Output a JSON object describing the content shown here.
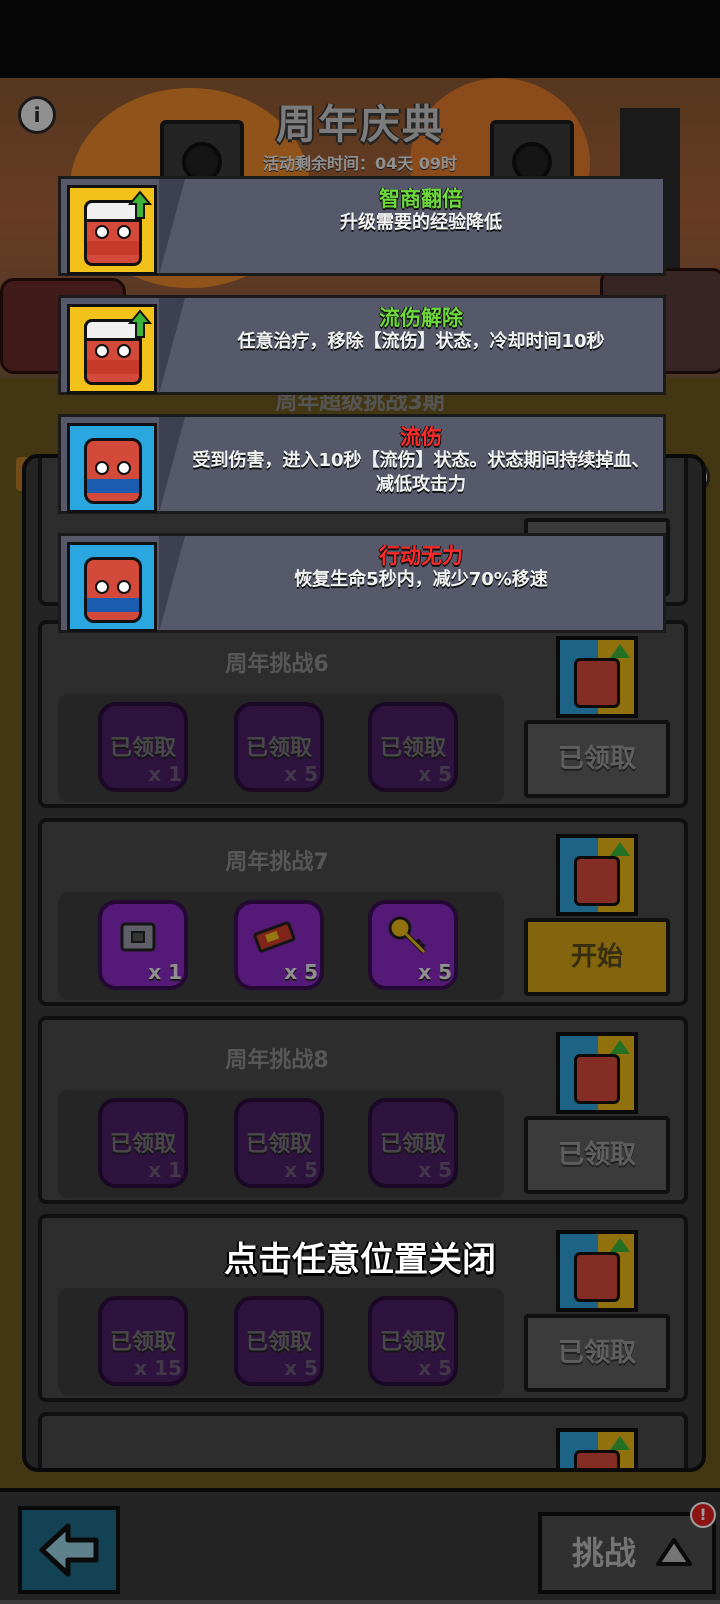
{
  "event": {
    "title": "周年庆典",
    "remaining_time": "活动剩余时间：04天 09时",
    "ribbon": "周年超级挑战3期"
  },
  "tooltips": [
    {
      "name": "智商翻倍",
      "desc": "升级需要的经验降低",
      "name_color": "#6dd83a",
      "icon_bg": "#f2c21a",
      "icon": "hero-upgrade-icon"
    },
    {
      "name": "流伤解除",
      "desc": "任意治疗，移除【流伤】状态，冷却时间10秒",
      "name_color": "#6dd83a",
      "icon_bg": "#f2c21a",
      "icon": "hero-upgrade-icon"
    },
    {
      "name": "流伤",
      "desc": "受到伤害，进入10秒【流伤】状态。状态期间持续掉血、减低攻击力",
      "name_color": "#ff2a2a",
      "icon_bg": "#2aa6e0",
      "icon": "red-slime-icon"
    },
    {
      "name": "行动无力",
      "desc": "恢复生命5秒内，减少70%移速",
      "name_color": "#ff2a2a",
      "icon_bg": "#2aa6e0",
      "icon": "red-slime-icon"
    }
  ],
  "challenges": [
    {
      "title": "周年挑战6",
      "button": "已领取",
      "state": "done",
      "rewards": [
        {
          "qty": "x 1",
          "label": "已领取",
          "icon": "chest-icon"
        },
        {
          "qty": "x 5",
          "label": "已领取",
          "icon": "ticket-icon"
        },
        {
          "qty": "x 5",
          "label": "已领取",
          "icon": "key-icon"
        }
      ]
    },
    {
      "title": "周年挑战7",
      "button": "开始",
      "state": "start",
      "rewards": [
        {
          "qty": "x 1",
          "label": "",
          "icon": "chest-icon"
        },
        {
          "qty": "x 5",
          "label": "",
          "icon": "ticket-icon"
        },
        {
          "qty": "x 5",
          "label": "",
          "icon": "key-icon"
        }
      ]
    },
    {
      "title": "周年挑战8",
      "button": "已领取",
      "state": "done",
      "rewards": [
        {
          "qty": "x 1",
          "label": "已领取",
          "icon": "chest-icon"
        },
        {
          "qty": "x 5",
          "label": "已领取",
          "icon": "ticket-icon"
        },
        {
          "qty": "x 5",
          "label": "已领取",
          "icon": "key-icon"
        }
      ]
    },
    {
      "title": "",
      "button": "已领取",
      "state": "done",
      "rewards": [
        {
          "qty": "x 15",
          "label": "已领取",
          "icon": "key-icon"
        },
        {
          "qty": "x 5",
          "label": "已领取",
          "icon": "ticket-icon"
        },
        {
          "qty": "x 5",
          "label": "已领取",
          "icon": "key-icon"
        }
      ]
    }
  ],
  "close_hint": "点击任意位置关闭",
  "bottom": {
    "challenge_label": "挑战",
    "badge": "!"
  }
}
